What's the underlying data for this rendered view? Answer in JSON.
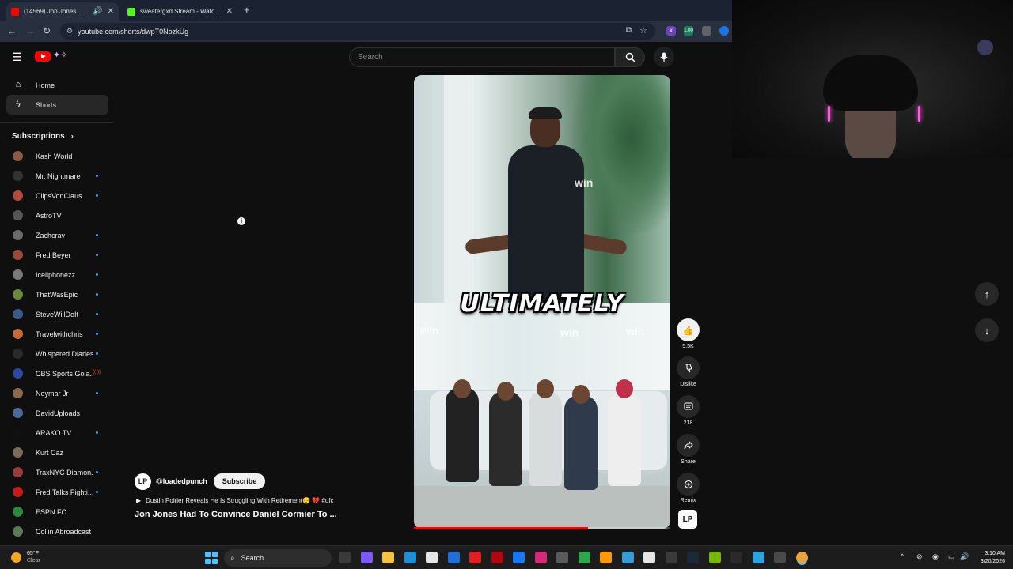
{
  "browser": {
    "tabs": [
      {
        "title": "(14569) Jon Jones Had To Co",
        "favicon_color": "#ff0000",
        "active": true
      },
      {
        "title": "sweatergxd Stream - Watch Live",
        "favicon_color": "#53fc18",
        "active": false
      }
    ],
    "url": "youtube.com/shorts/dwpT0NozkUg",
    "extensions": [
      {
        "icon": "k-extension-icon",
        "label": "k",
        "color": "#6f42c1"
      },
      {
        "icon": "stat-extension-icon",
        "label": "1.00",
        "color": "#1a7f5a"
      },
      {
        "icon": "puzzle-extension-icon",
        "label": "",
        "color": "#5f6368"
      },
      {
        "icon": "shield-extension-icon",
        "label": "",
        "color": "#1a73e8"
      }
    ]
  },
  "youtube": {
    "search_placeholder": "Search",
    "sidebar": {
      "nav": [
        {
          "label": "Home",
          "icon": "home-icon",
          "active": false
        },
        {
          "label": "Shorts",
          "icon": "shorts-icon",
          "active": true
        }
      ],
      "subscriptions_heading": "Subscriptions",
      "subscriptions": [
        {
          "name": "Kash World",
          "color": "#8a5a44",
          "dot": false
        },
        {
          "name": "Mr. Nightmare",
          "color": "#333333",
          "dot": true
        },
        {
          "name": "ClipsVonClaus",
          "color": "#b44a3a",
          "dot": true
        },
        {
          "name": "AstroTV",
          "color": "#555555",
          "dot": false
        },
        {
          "name": "Zachcray",
          "color": "#6b6b6b",
          "dot": true
        },
        {
          "name": "Fred Beyer",
          "color": "#9b4a3a",
          "dot": true
        },
        {
          "name": "Icellphonezz",
          "color": "#7a7a7a",
          "dot": true
        },
        {
          "name": "ThatWasEpic",
          "color": "#6a8a3a",
          "dot": true
        },
        {
          "name": "SteveWillDoIt",
          "color": "#3a5a8a",
          "dot": true
        },
        {
          "name": "Travelwithchris",
          "color": "#c46a3a",
          "dot": true
        },
        {
          "name": "Whispered Diaries",
          "color": "#2a2a2a",
          "dot": true
        },
        {
          "name": "CBS Sports Gola...",
          "color": "#2a4aa0",
          "live": "((•))"
        },
        {
          "name": "Neymar Jr",
          "color": "#8a6a4a",
          "dot": true
        },
        {
          "name": "DavidUploads",
          "color": "#4a6a9a",
          "dot": false
        },
        {
          "name": "ARAKO TV",
          "color": "#111111",
          "dot": true
        },
        {
          "name": "Kurt Caz",
          "color": "#7a6a5a",
          "dot": false
        },
        {
          "name": "TraxNYC Diamon...",
          "color": "#9a3a3a",
          "dot": true
        },
        {
          "name": "Fred Talks Fighti...",
          "color": "#c41a1a",
          "dot": true
        },
        {
          "name": "ESPN FC",
          "color": "#2a8a3a",
          "dot": false
        },
        {
          "name": "Collin Abroadcast",
          "color": "#5a7a5a",
          "dot": false
        }
      ]
    },
    "short": {
      "caption": "ULTIMATELY",
      "watermarks": [
        "win",
        "win",
        "win",
        "win"
      ],
      "progress": 0.68,
      "channel_handle": "@loadedpunch",
      "channel_avatar_text": "LP",
      "subscribe_label": "Subscribe",
      "playlist": "Dustin Poirier Reveals He Is Struggling With Retirement😔 💔  #ufc",
      "title": "Jon Jones Had To Convince Daniel Cormier To ...",
      "actions": {
        "like_count": "5.5K",
        "dislike_label": "Dislike",
        "comment_count": "218",
        "share_label": "Share",
        "remix_label": "Remix"
      }
    }
  },
  "taskbar": {
    "weather_temp": "65°F",
    "weather_desc": "Clear",
    "search_label": "Search",
    "time": "3:10 AM",
    "date": "3/20/2026",
    "apps": [
      {
        "icon": "task-view-icon",
        "color": "#3a3a3a"
      },
      {
        "icon": "copilot-icon",
        "color": "#7a5af8"
      },
      {
        "icon": "file-explorer-icon",
        "color": "#f5c242"
      },
      {
        "icon": "edge-icon",
        "color": "#1e8fd6"
      },
      {
        "icon": "store-icon",
        "color": "#e6e6e6"
      },
      {
        "icon": "outlook-icon",
        "color": "#1f6fd6"
      },
      {
        "icon": "youtube-app-icon",
        "color": "#e02020"
      },
      {
        "icon": "netflix-icon",
        "color": "#b1060f"
      },
      {
        "icon": "facebook-icon",
        "color": "#1877f2"
      },
      {
        "icon": "instagram-icon",
        "color": "#d62976"
      },
      {
        "icon": "clapper-icon",
        "color": "#5a5a5a"
      },
      {
        "icon": "green-app-icon",
        "color": "#2aa84a"
      },
      {
        "icon": "amazon-icon",
        "color": "#ff9900"
      },
      {
        "icon": "grid-app-icon",
        "color": "#3a9ad6"
      },
      {
        "icon": "notes-icon",
        "color": "#e6e6e6"
      },
      {
        "icon": "back-app-icon",
        "color": "#3a3a3a"
      },
      {
        "icon": "steam-icon",
        "color": "#1b2838"
      },
      {
        "icon": "nvidia-icon",
        "color": "#76b900"
      },
      {
        "icon": "epic-games-icon",
        "color": "#2a2a2a"
      },
      {
        "icon": "telegram-icon",
        "color": "#2aa3e0"
      },
      {
        "icon": "settings-app-icon",
        "color": "#4a4a4a"
      },
      {
        "icon": "chrome-icon",
        "color": "#e8a33a"
      }
    ]
  }
}
